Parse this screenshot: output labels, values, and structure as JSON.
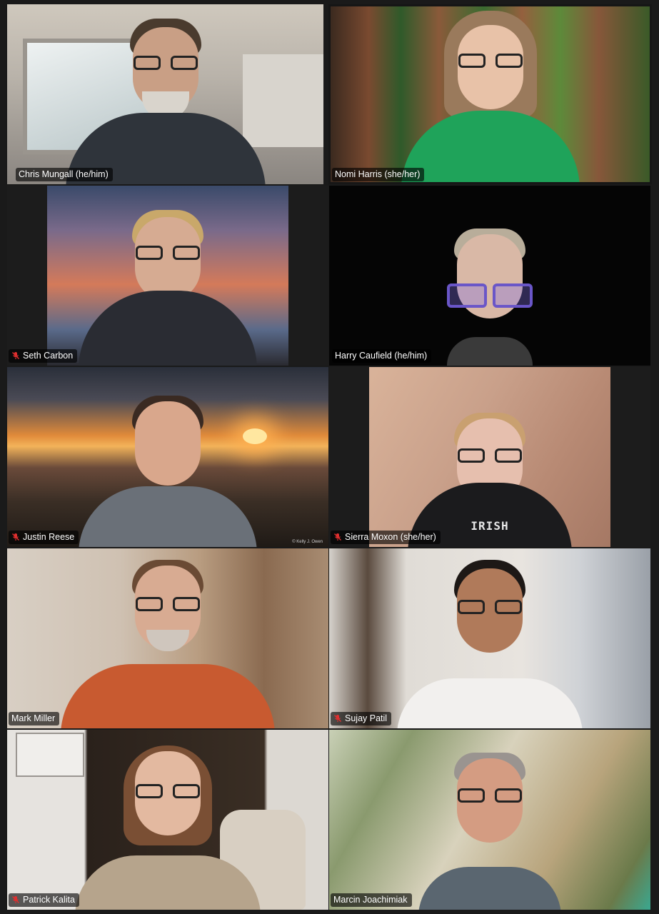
{
  "meeting": {
    "participants": [
      {
        "name": "Chris Mungall (he/him)",
        "muted": false
      },
      {
        "name": "Nomi Harris (she/her)",
        "muted": false
      },
      {
        "name": "Seth Carbon",
        "muted": true
      },
      {
        "name": "Harry Caufield (he/him)",
        "muted": false
      },
      {
        "name": "Justin Reese",
        "muted": true
      },
      {
        "name": "Sierra Moxon (she/her)",
        "muted": true
      },
      {
        "name": "Mark Miller",
        "muted": false
      },
      {
        "name": "Sujay Patil",
        "muted": true
      },
      {
        "name": "Patrick Kalita",
        "muted": true
      },
      {
        "name": "Marcin Joachimiak",
        "muted": false
      }
    ],
    "shirt_text": "IRISH",
    "background_credit": "© Kelly J. Owen"
  },
  "colors": {
    "muted_icon": "#e02f2f",
    "name_tag_bg": "rgba(0,0,0,0.62)",
    "name_text": "#ffffff"
  },
  "icons": {
    "muted": "microphone-off-icon"
  }
}
